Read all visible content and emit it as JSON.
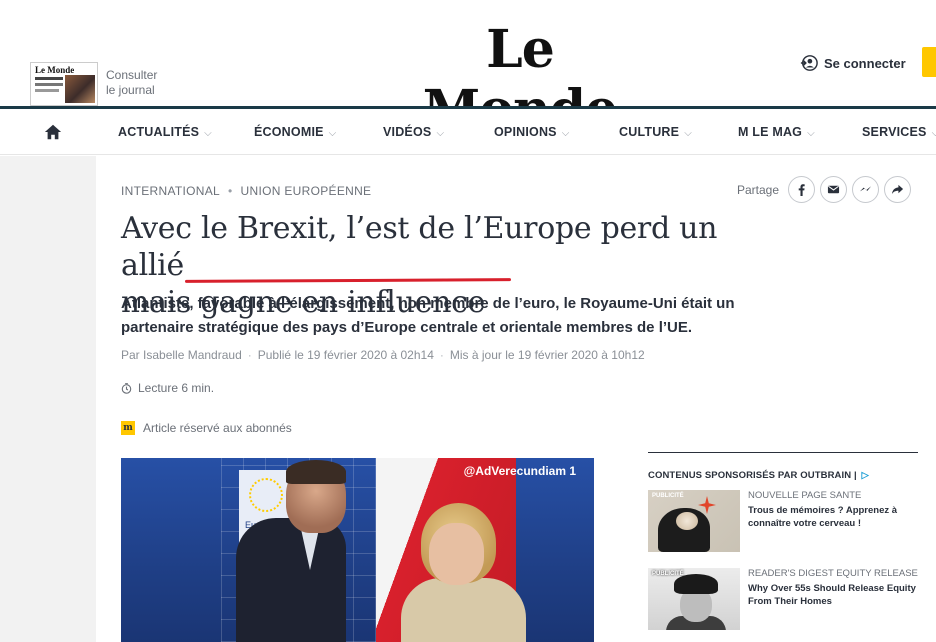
{
  "header": {
    "logo": "Le Monde",
    "paper_thumb_masthead": "Le Monde",
    "consult_line1": "Consulter",
    "consult_line2": "le journal",
    "login_label": "Se connecter"
  },
  "nav": {
    "items": [
      {
        "label": "ACTUALITÉS"
      },
      {
        "label": "ÉCONOMIE"
      },
      {
        "label": "VIDÉOS"
      },
      {
        "label": "OPINIONS"
      },
      {
        "label": "CULTURE"
      },
      {
        "label": "M LE MAG"
      },
      {
        "label": "SERVICES"
      }
    ]
  },
  "article": {
    "kicker": [
      "INTERNATIONAL",
      "UNION EUROPÉENNE"
    ],
    "share_label": "Partage",
    "title_line1": "Avec le Brexit, l’est de l’Europe perd un allié",
    "title_line2": "mais gagne en influence",
    "lede": "Atlantiste, favorable à l’élargissement, non membre de l’euro, le Royaume-Uni était un partenaire stratégique des pays d’Europe centrale et orientale membres de l’UE.",
    "author": "Par Isabelle Mandraud",
    "published": "Publié le 19 février 2020 à 02h14",
    "updated": "Mis à jour le 19 février 2020 à 10h12",
    "reading_time": "Lecture 6 min.",
    "subscriber_badge": "m",
    "subscriber_note": "Article réservé aux abonnés",
    "photo_credit": "@AdVerecundiam 1",
    "photo_sign_text": "Europe Comm"
  },
  "sponsored": {
    "heading": "CONTENUS SPONSORISÉS PAR",
    "brand": "OUTBRAIN",
    "ad_glyph": "▷",
    "cards": [
      {
        "tag": "PUBLICITÉ",
        "source": "NOUVELLE PAGE SANTE",
        "title": "Trous de mémoires ? Apprenez à connaître votre cerveau !"
      },
      {
        "tag": "PUBLICITÉ",
        "source": "READER'S DIGEST EQUITY RELEASE",
        "title": "Why Over 55s Should Release Equity From Their Homes"
      }
    ]
  },
  "colors": {
    "accent_underline": "#d8202c",
    "header_rule": "#1a3a47",
    "subscriber_yellow": "#ffc700",
    "text": "#2a303b"
  },
  "icons": {
    "home": "home-icon",
    "login": "user-login-icon",
    "share": [
      "facebook-icon",
      "email-icon",
      "messenger-icon",
      "share-arrow-icon"
    ],
    "reading": "clock-icon"
  }
}
